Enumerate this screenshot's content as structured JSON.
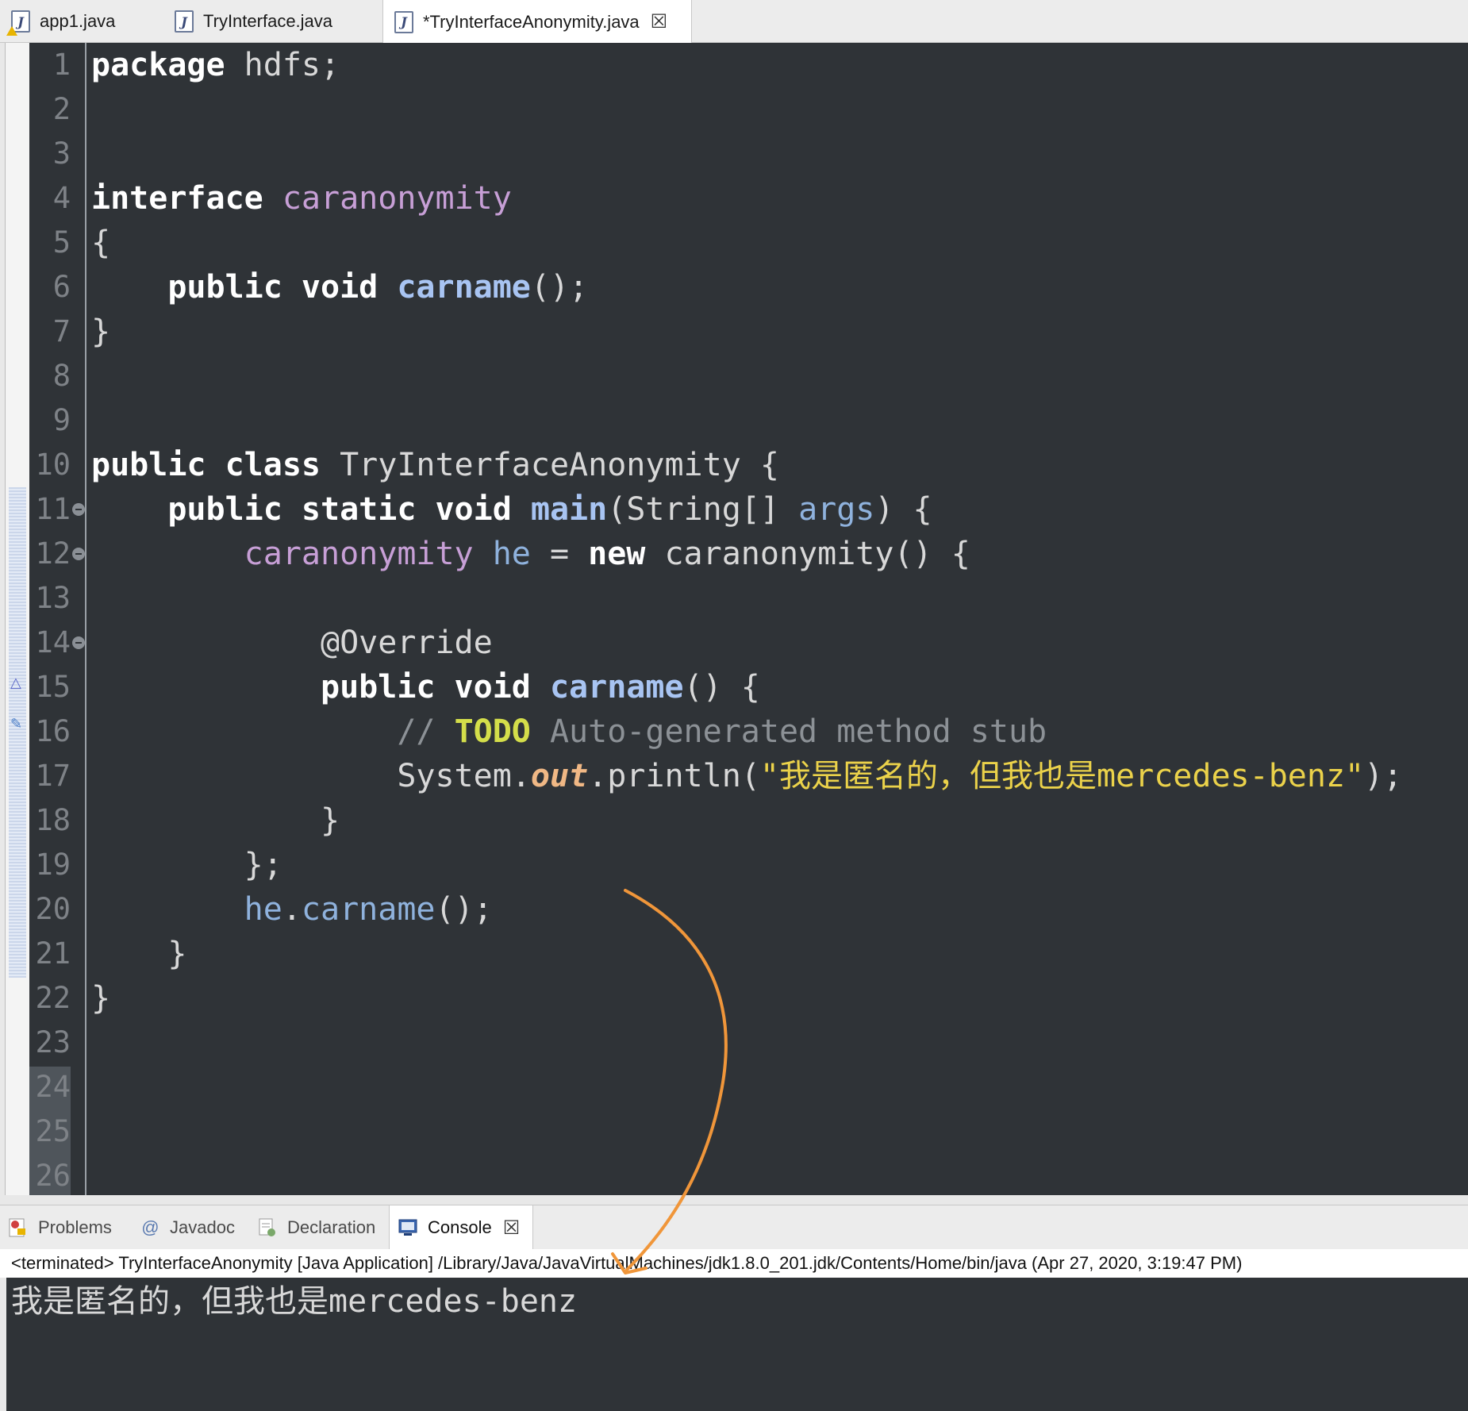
{
  "editor_tabs": [
    {
      "label": "app1.java"
    },
    {
      "label": "TryInterface.java"
    },
    {
      "label": "*TryInterfaceAnonymity.java"
    }
  ],
  "icons": {
    "java_file": "J",
    "close": "☒"
  },
  "line_numbers": [
    "1",
    "2",
    "3",
    "4",
    "5",
    "6",
    "7",
    "8",
    "9",
    "10",
    "11",
    "12",
    "13",
    "14",
    "15",
    "16",
    "17",
    "18",
    "19",
    "20",
    "21",
    "22",
    "23",
    "24",
    "25",
    "26"
  ],
  "code": {
    "l1": {
      "kw": "package",
      "rest": " hdfs;"
    },
    "l4": {
      "kw": "interface",
      "ty": " caranonymity"
    },
    "l5": {
      "text": "{"
    },
    "l6": {
      "kw": "    public void",
      "mth": " carname",
      "rest": "();"
    },
    "l7": {
      "text": "}"
    },
    "l10": {
      "kw": "public class",
      "rest": " TryInterfaceAnonymity {"
    },
    "l11": {
      "kw": "    public static void",
      "mth": " main",
      "rest1": "(String[] ",
      "var": "args",
      "rest2": ") {"
    },
    "l12": {
      "indent": "        ",
      "ty": "caranonymity",
      "var": " he",
      "rest1": " = ",
      "kw": "new",
      "rest2": " caranonymity() {"
    },
    "l14": {
      "ann": "            @Override"
    },
    "l15": {
      "kw": "            public void",
      "mth": " carname",
      "rest": "() {"
    },
    "l16": {
      "cmt1": "                // ",
      "todo": "TODO",
      "cmt2": " Auto-generated method stub"
    },
    "l17": {
      "rest1": "                System.",
      "fld": "out",
      "rest2": ".println(",
      "str": "\"我是匿名的，但我也是mercedes-benz\"",
      "rest3": ");"
    },
    "l18": {
      "text": "            }"
    },
    "l19": {
      "text": "        };"
    },
    "l20": {
      "indent": "        ",
      "var": "he",
      "rest1": ".",
      "var2": "carname",
      "rest2": "();"
    },
    "l21": {
      "text": "    }"
    },
    "l22": {
      "text": "}"
    }
  },
  "panel_tabs": [
    {
      "label": "Problems"
    },
    {
      "label": "Javadoc"
    },
    {
      "label": "Declaration"
    },
    {
      "label": "Console"
    }
  ],
  "console": {
    "status": "<terminated> TryInterfaceAnonymity [Java Application] /Library/Java/JavaVirtualMachines/jdk1.8.0_201.jdk/Contents/Home/bin/java (Apr 27, 2020, 3:19:47 PM)",
    "output": "我是匿名的，但我也是mercedes-benz"
  },
  "colors": {
    "editor_bg": "#2f3337",
    "arrow": "#f0963a"
  }
}
